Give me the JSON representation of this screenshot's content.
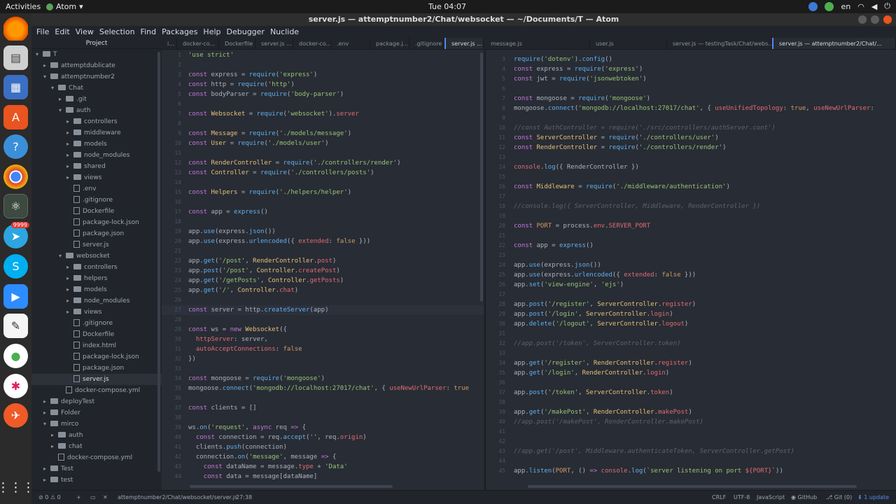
{
  "topbar": {
    "activities": "Activities",
    "app": "Atom",
    "clock": "Tue 04:07",
    "lang": "en"
  },
  "dock": {
    "telegram_badge": "9999"
  },
  "window": {
    "title": "server.js — attemptnumber2/Chat/websocket — ~/Documents/T — Atom"
  },
  "menu": [
    "File",
    "Edit",
    "View",
    "Selection",
    "Find",
    "Packages",
    "Help",
    "Debugger",
    "Nuclide"
  ],
  "project": {
    "title": "Project",
    "tree": [
      {
        "label": "T",
        "indent": 0,
        "type": "folder",
        "open": true
      },
      {
        "label": "attemptdublicate",
        "indent": 1,
        "type": "folder",
        "open": false
      },
      {
        "label": "attemptnumber2",
        "indent": 1,
        "type": "folder",
        "open": true
      },
      {
        "label": "Chat",
        "indent": 2,
        "type": "folder",
        "open": true
      },
      {
        "label": ".git",
        "indent": 3,
        "type": "folder",
        "open": false
      },
      {
        "label": "auth",
        "indent": 3,
        "type": "folder",
        "open": true
      },
      {
        "label": "controllers",
        "indent": 4,
        "type": "folder",
        "open": false
      },
      {
        "label": "middleware",
        "indent": 4,
        "type": "folder",
        "open": false
      },
      {
        "label": "models",
        "indent": 4,
        "type": "folder",
        "open": false
      },
      {
        "label": "node_modules",
        "indent": 4,
        "type": "folder",
        "open": false
      },
      {
        "label": "shared",
        "indent": 4,
        "type": "folder",
        "open": false
      },
      {
        "label": "views",
        "indent": 4,
        "type": "folder",
        "open": false
      },
      {
        "label": ".env",
        "indent": 4,
        "type": "file"
      },
      {
        "label": ".gitignore",
        "indent": 4,
        "type": "file"
      },
      {
        "label": "Dockerfile",
        "indent": 4,
        "type": "file"
      },
      {
        "label": "package-lock.json",
        "indent": 4,
        "type": "file"
      },
      {
        "label": "package.json",
        "indent": 4,
        "type": "file"
      },
      {
        "label": "server.js",
        "indent": 4,
        "type": "file"
      },
      {
        "label": "websocket",
        "indent": 3,
        "type": "folder",
        "open": true
      },
      {
        "label": "controllers",
        "indent": 4,
        "type": "folder",
        "open": false
      },
      {
        "label": "helpers",
        "indent": 4,
        "type": "folder",
        "open": false
      },
      {
        "label": "models",
        "indent": 4,
        "type": "folder",
        "open": false
      },
      {
        "label": "node_modules",
        "indent": 4,
        "type": "folder",
        "open": false
      },
      {
        "label": "views",
        "indent": 4,
        "type": "folder",
        "open": false
      },
      {
        "label": ".gitignore",
        "indent": 4,
        "type": "file"
      },
      {
        "label": "Dockerfile",
        "indent": 4,
        "type": "file"
      },
      {
        "label": "index.html",
        "indent": 4,
        "type": "file"
      },
      {
        "label": "package-lock.json",
        "indent": 4,
        "type": "file"
      },
      {
        "label": "package.json",
        "indent": 4,
        "type": "file"
      },
      {
        "label": "server.js",
        "indent": 4,
        "type": "file",
        "selected": true
      },
      {
        "label": "docker-compose.yml",
        "indent": 3,
        "type": "file"
      },
      {
        "label": "deployTest",
        "indent": 1,
        "type": "folder",
        "open": false
      },
      {
        "label": "Folder",
        "indent": 1,
        "type": "folder",
        "open": false
      },
      {
        "label": "mirco",
        "indent": 1,
        "type": "folder",
        "open": true
      },
      {
        "label": "auth",
        "indent": 2,
        "type": "folder",
        "open": false
      },
      {
        "label": "chat",
        "indent": 2,
        "type": "folder",
        "open": false
      },
      {
        "label": "docker-compose.yml",
        "indent": 2,
        "type": "file"
      },
      {
        "label": "Test",
        "indent": 1,
        "type": "folder",
        "open": false
      },
      {
        "label": "test",
        "indent": 1,
        "type": "folder",
        "open": false
      }
    ]
  },
  "tabs_left": [
    {
      "label": "i...",
      "active": false
    },
    {
      "label": "docker-co...",
      "active": false
    },
    {
      "label": "Dockerfile",
      "active": false
    },
    {
      "label": "server.js ...",
      "active": false
    },
    {
      "label": "docker-co...",
      "active": false
    },
    {
      "label": ".env",
      "active": false
    },
    {
      "label": "package.j...",
      "active": false
    },
    {
      "label": ".gitignore",
      "active": false
    },
    {
      "label": "server.js ...",
      "active": true
    }
  ],
  "tabs_right": [
    {
      "label": "message.js",
      "active": false
    },
    {
      "label": "user.js",
      "active": false
    },
    {
      "label": "server.js — testingTask/Chat/webs...",
      "active": false
    },
    {
      "label": "server.js — attemptnumber2/Chat/...",
      "active": true
    }
  ],
  "editor_left": {
    "lines": [
      {
        "n": "1",
        "html": "<span class='s'>'use strict'</span>"
      },
      {
        "n": "2",
        "html": ""
      },
      {
        "n": "3",
        "html": "<span class='k'>const</span> express = <span class='f'>require</span>(<span class='s'>'express'</span>)"
      },
      {
        "n": "4",
        "html": "<span class='k'>const</span> http = <span class='f'>require</span>(<span class='s'>'http'</span>)"
      },
      {
        "n": "5",
        "html": "<span class='k'>const</span> bodyParser = <span class='f'>require</span>(<span class='s'>'body-parser'</span>)"
      },
      {
        "n": "6",
        "html": ""
      },
      {
        "n": "7",
        "html": "<span class='k'>const</span> <span class='t'>Websocket</span> = <span class='f'>require</span>(<span class='s'>'websocket'</span>).<span class='v'>server</span>"
      },
      {
        "n": "8",
        "html": ""
      },
      {
        "n": "9",
        "html": "<span class='k'>const</span> <span class='t'>Message</span> = <span class='f'>require</span>(<span class='s'>'./models/message'</span>)"
      },
      {
        "n": "10",
        "html": "<span class='k'>const</span> <span class='t'>User</span> = <span class='f'>require</span>(<span class='s'>'./models/user'</span>)"
      },
      {
        "n": "11",
        "html": ""
      },
      {
        "n": "12",
        "html": "<span class='k'>const</span> <span class='t'>RenderController</span> = <span class='f'>require</span>(<span class='s'>'./controllers/render'</span>)"
      },
      {
        "n": "13",
        "html": "<span class='k'>const</span> <span class='t'>Controller</span> = <span class='f'>require</span>(<span class='s'>'./controllers/posts'</span>)"
      },
      {
        "n": "14",
        "html": ""
      },
      {
        "n": "15",
        "html": "<span class='k'>const</span> <span class='t'>Helpers</span> = <span class='f'>require</span>(<span class='s'>'./helpers/helper'</span>)"
      },
      {
        "n": "16",
        "html": ""
      },
      {
        "n": "17",
        "html": "<span class='k'>const</span> app = <span class='f'>express</span>()"
      },
      {
        "n": "18",
        "html": ""
      },
      {
        "n": "19",
        "html": "app.<span class='f'>use</span>(express.<span class='f'>json</span>())"
      },
      {
        "n": "20",
        "html": "app.<span class='f'>use</span>(express.<span class='f'>urlencoded</span>({ <span class='v'>extended</span>: <span class='n'>false</span> }))"
      },
      {
        "n": "21",
        "html": ""
      },
      {
        "n": "22",
        "html": "app.<span class='f'>get</span>(<span class='s'>'/post'</span>, <span class='t'>RenderController</span>.<span class='v'>post</span>)"
      },
      {
        "n": "23",
        "html": "app.<span class='f'>post</span>(<span class='s'>'/post'</span>, <span class='t'>Controller</span>.<span class='v'>createPost</span>)"
      },
      {
        "n": "24",
        "html": "app.<span class='f'>get</span>(<span class='s'>'/getPosts'</span>, <span class='t'>Controller</span>.<span class='v'>getPosts</span>)"
      },
      {
        "n": "25",
        "html": "app.<span class='f'>get</span>(<span class='s'>'/'</span>, <span class='t'>Controller</span>.<span class='v'>chat</span>)"
      },
      {
        "n": "26",
        "html": ""
      },
      {
        "n": "27",
        "html": "<span class='k'>const</span> server = http.<span class='f'>createServer</span>(app)"
      },
      {
        "n": "28",
        "html": ""
      },
      {
        "n": "29",
        "html": "<span class='k'>const</span> ws = <span class='k'>new</span> <span class='t'>Websocket</span>({"
      },
      {
        "n": "30",
        "html": "  <span class='v'>httpServer</span>: server,"
      },
      {
        "n": "31",
        "html": "  <span class='v'>autoAcceptConnections</span>: <span class='n'>false</span>"
      },
      {
        "n": "32",
        "html": "})"
      },
      {
        "n": "33",
        "html": ""
      },
      {
        "n": "34",
        "html": "<span class='k'>const</span> mongoose = <span class='f'>require</span>(<span class='s'>'mongoose'</span>)"
      },
      {
        "n": "35",
        "html": "mongoose.<span class='f'>connect</span>(<span class='s'>'mongodb://localhost:27017/chat'</span>, { <span class='v'>useNewUrlParser</span>: <span class='n'>true</span>"
      },
      {
        "n": "36",
        "html": ""
      },
      {
        "n": "37",
        "html": "<span class='k'>const</span> clients = []"
      },
      {
        "n": "38",
        "html": ""
      },
      {
        "n": "39",
        "html": "ws.<span class='f'>on</span>(<span class='s'>'request'</span>, <span class='k'>async</span> req <span class='k'>=&gt;</span> {"
      },
      {
        "n": "40",
        "html": "  <span class='k'>const</span> connection = req.<span class='f'>accept</span>(<span class='s'>''</span>, req.<span class='v'>origin</span>)"
      },
      {
        "n": "41",
        "html": "  clients.<span class='f'>push</span>(connection)"
      },
      {
        "n": "42",
        "html": "  connection.<span class='f'>on</span>(<span class='s'>'message'</span>, message <span class='k'>=&gt;</span> {"
      },
      {
        "n": "43",
        "html": "    <span class='k'>const</span> dataName = message.<span class='v'>type</span> + <span class='s'>'Data'</span>"
      },
      {
        "n": "44",
        "html": "    <span class='k'>const</span> data = message[dataName]"
      }
    ]
  },
  "editor_right": {
    "lines": [
      {
        "n": "3",
        "html": "<span class='f'>require</span>(<span class='s'>'dotenv'</span>).<span class='f'>config</span>()"
      },
      {
        "n": "4",
        "html": "<span class='k'>const</span> express = <span class='f'>require</span>(<span class='s'>'express'</span>)"
      },
      {
        "n": "5",
        "html": "<span class='k'>const</span> jwt = <span class='f'>require</span>(<span class='s'>'jsonwebtoken'</span>)"
      },
      {
        "n": "6",
        "html": ""
      },
      {
        "n": "7",
        "html": "<span class='k'>const</span> mongoose = <span class='f'>require</span>(<span class='s'>'mongoose'</span>)"
      },
      {
        "n": "8",
        "html": "mongoose.<span class='f'>connect</span>(<span class='s'>'mongodb://localhost:27017/chat'</span>, { <span class='v'>useUnifiedTopology</span>: <span class='n'>true</span>, <span class='v'>useNewUrlParser</span>:"
      },
      {
        "n": "9",
        "html": ""
      },
      {
        "n": "10",
        "html": "<span class='c'>//const AuthController = require('./src/controllers/authServer.cont')</span>"
      },
      {
        "n": "11",
        "html": "<span class='k'>const</span> <span class='t'>ServerController</span> = <span class='f'>require</span>(<span class='s'>'./controllers/user'</span>)"
      },
      {
        "n": "12",
        "html": "<span class='k'>const</span> <span class='t'>RenderController</span> = <span class='f'>require</span>(<span class='s'>'./controllers/render'</span>)"
      },
      {
        "n": "13",
        "html": ""
      },
      {
        "n": "14",
        "html": "<span class='v'>console</span>.<span class='f'>log</span>({ RenderController })"
      },
      {
        "n": "15",
        "html": ""
      },
      {
        "n": "16",
        "html": "<span class='k'>const</span> <span class='t'>Middleware</span> = <span class='f'>require</span>(<span class='s'>'./middleware/authentication'</span>)"
      },
      {
        "n": "17",
        "html": ""
      },
      {
        "n": "18",
        "html": "<span class='c'>//console.log({ ServerController, Middleware, RenderController })</span>"
      },
      {
        "n": "19",
        "html": ""
      },
      {
        "n": "20",
        "html": "<span class='k'>const</span> <span class='n'>PORT</span> = process.<span class='v'>env</span>.<span class='v'>SERVER_PORT</span>"
      },
      {
        "n": "21",
        "html": ""
      },
      {
        "n": "22",
        "html": "<span class='k'>const</span> app = <span class='f'>express</span>()"
      },
      {
        "n": "23",
        "html": ""
      },
      {
        "n": "24",
        "html": "app.<span class='f'>use</span>(express.<span class='f'>json</span>())"
      },
      {
        "n": "25",
        "html": "app.<span class='f'>use</span>(express.<span class='f'>urlencoded</span>({ <span class='v'>extended</span>: <span class='n'>false</span> }))"
      },
      {
        "n": "26",
        "html": "app.<span class='f'>set</span>(<span class='s'>'view-engine'</span>, <span class='s'>'ejs'</span>)"
      },
      {
        "n": "27",
        "html": ""
      },
      {
        "n": "28",
        "html": "app.<span class='f'>post</span>(<span class='s'>'/register'</span>, <span class='t'>ServerController</span>.<span class='v'>register</span>)"
      },
      {
        "n": "29",
        "html": "app.<span class='f'>post</span>(<span class='s'>'/login'</span>, <span class='t'>ServerController</span>.<span class='v'>login</span>)"
      },
      {
        "n": "30",
        "html": "app.<span class='f'>delete</span>(<span class='s'>'/logout'</span>, <span class='t'>ServerController</span>.<span class='v'>logout</span>)"
      },
      {
        "n": "31",
        "html": ""
      },
      {
        "n": "32",
        "html": "<span class='c'>//app.post('/token', ServerController.token)</span>"
      },
      {
        "n": "33",
        "html": ""
      },
      {
        "n": "34",
        "html": "app.<span class='f'>get</span>(<span class='s'>'/register'</span>, <span class='t'>RenderController</span>.<span class='v'>register</span>)"
      },
      {
        "n": "35",
        "html": "app.<span class='f'>get</span>(<span class='s'>'/login'</span>, <span class='t'>RenderController</span>.<span class='v'>login</span>)"
      },
      {
        "n": "36",
        "html": ""
      },
      {
        "n": "37",
        "html": "app.<span class='f'>post</span>(<span class='s'>'/token'</span>, <span class='t'>ServerController</span>.<span class='v'>token</span>)"
      },
      {
        "n": "38",
        "html": ""
      },
      {
        "n": "39",
        "html": "app.<span class='f'>get</span>(<span class='s'>'/makePost'</span>, <span class='t'>RenderController</span>.<span class='v'>makePost</span>)"
      },
      {
        "n": "40",
        "html": "<span class='c'>//app.post('/makePost', RenderController.makePost)</span>"
      },
      {
        "n": "41",
        "html": ""
      },
      {
        "n": "42",
        "html": ""
      },
      {
        "n": "43",
        "html": "<span class='c'>//app.get('/post', Middleware.authenticateToken, ServerController.getPost)</span>"
      },
      {
        "n": "44",
        "html": ""
      },
      {
        "n": "45",
        "html": "app.<span class='f'>listen</span>(<span class='n'>PORT</span>, () <span class='k'>=&gt;</span> <span class='v'>console</span>.<span class='f'>log</span>(<span class='s'>`server listening on port <span class='v'>${PORT}</span>`</span>))"
      }
    ]
  },
  "status": {
    "errors": "0",
    "warnings": "0",
    "path": "attemptnumber2/Chat/websocket/server.js",
    "cursor": "27:38",
    "line_ending": "CRLF",
    "encoding": "UTF-8",
    "grammar": "JavaScript",
    "github": "GitHub",
    "git": "Git (0)",
    "update": "1 update"
  }
}
